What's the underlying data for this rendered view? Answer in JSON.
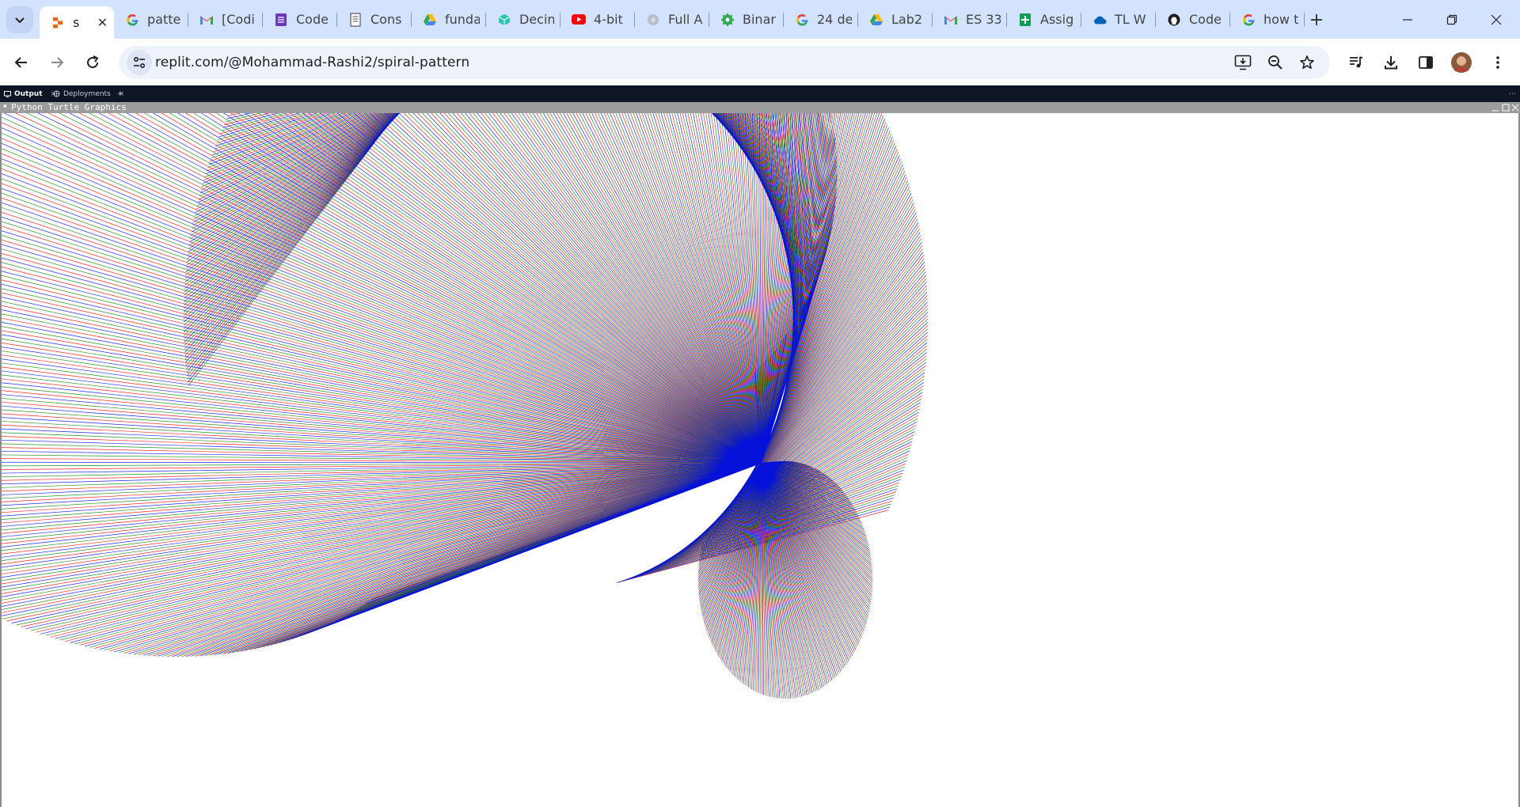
{
  "browser": {
    "colors": {
      "tabstrip": "#d3e3fd",
      "active_tab": "#ffffff",
      "omnibox": "#eef3fb"
    },
    "tabs": [
      {
        "label": "s",
        "icon": "replit-icon",
        "active": true,
        "close": "✕"
      },
      {
        "label": "patte",
        "icon": "google-icon"
      },
      {
        "label": "[Codi",
        "icon": "gmail-icon"
      },
      {
        "label": "Code",
        "icon": "forms-icon"
      },
      {
        "label": "Cons",
        "icon": "document-icon"
      },
      {
        "label": "funda",
        "icon": "drive-icon"
      },
      {
        "label": "Decin",
        "icon": "cube-icon"
      },
      {
        "label": "4-bit",
        "icon": "youtube-icon"
      },
      {
        "label": "Full A",
        "icon": "globe-icon"
      },
      {
        "label": "Binar",
        "icon": "gear-icon"
      },
      {
        "label": "24 de",
        "icon": "google-icon"
      },
      {
        "label": "Lab2",
        "icon": "drive-icon"
      },
      {
        "label": "ES 33",
        "icon": "gmail-icon"
      },
      {
        "label": "Assig",
        "icon": "sheets-icon"
      },
      {
        "label": "TL W",
        "icon": "onedrive-icon"
      },
      {
        "label": "Code",
        "icon": "github-icon"
      },
      {
        "label": "how t",
        "icon": "google-icon"
      }
    ],
    "new_tab_label": "+",
    "url": "replit.com/@Mohammad-Rashi2/spiral-pattern"
  },
  "replit": {
    "tabs": [
      {
        "label": "Output",
        "icon": "monitor-icon",
        "close": "×"
      },
      {
        "label": "Deployments",
        "icon": "deploy-icon",
        "close": "×"
      }
    ],
    "add_tab_label": "+",
    "more_label": "⋯",
    "turtle_window_title": "Python Turtle Graphics",
    "colors": {
      "panel_bg": "#0e1525",
      "title_bar": "#9c9c9c"
    }
  },
  "drawing": {
    "pen_colors": [
      "#ff0000",
      "#008000",
      "#0000ff"
    ],
    "stroke_count": 480
  }
}
